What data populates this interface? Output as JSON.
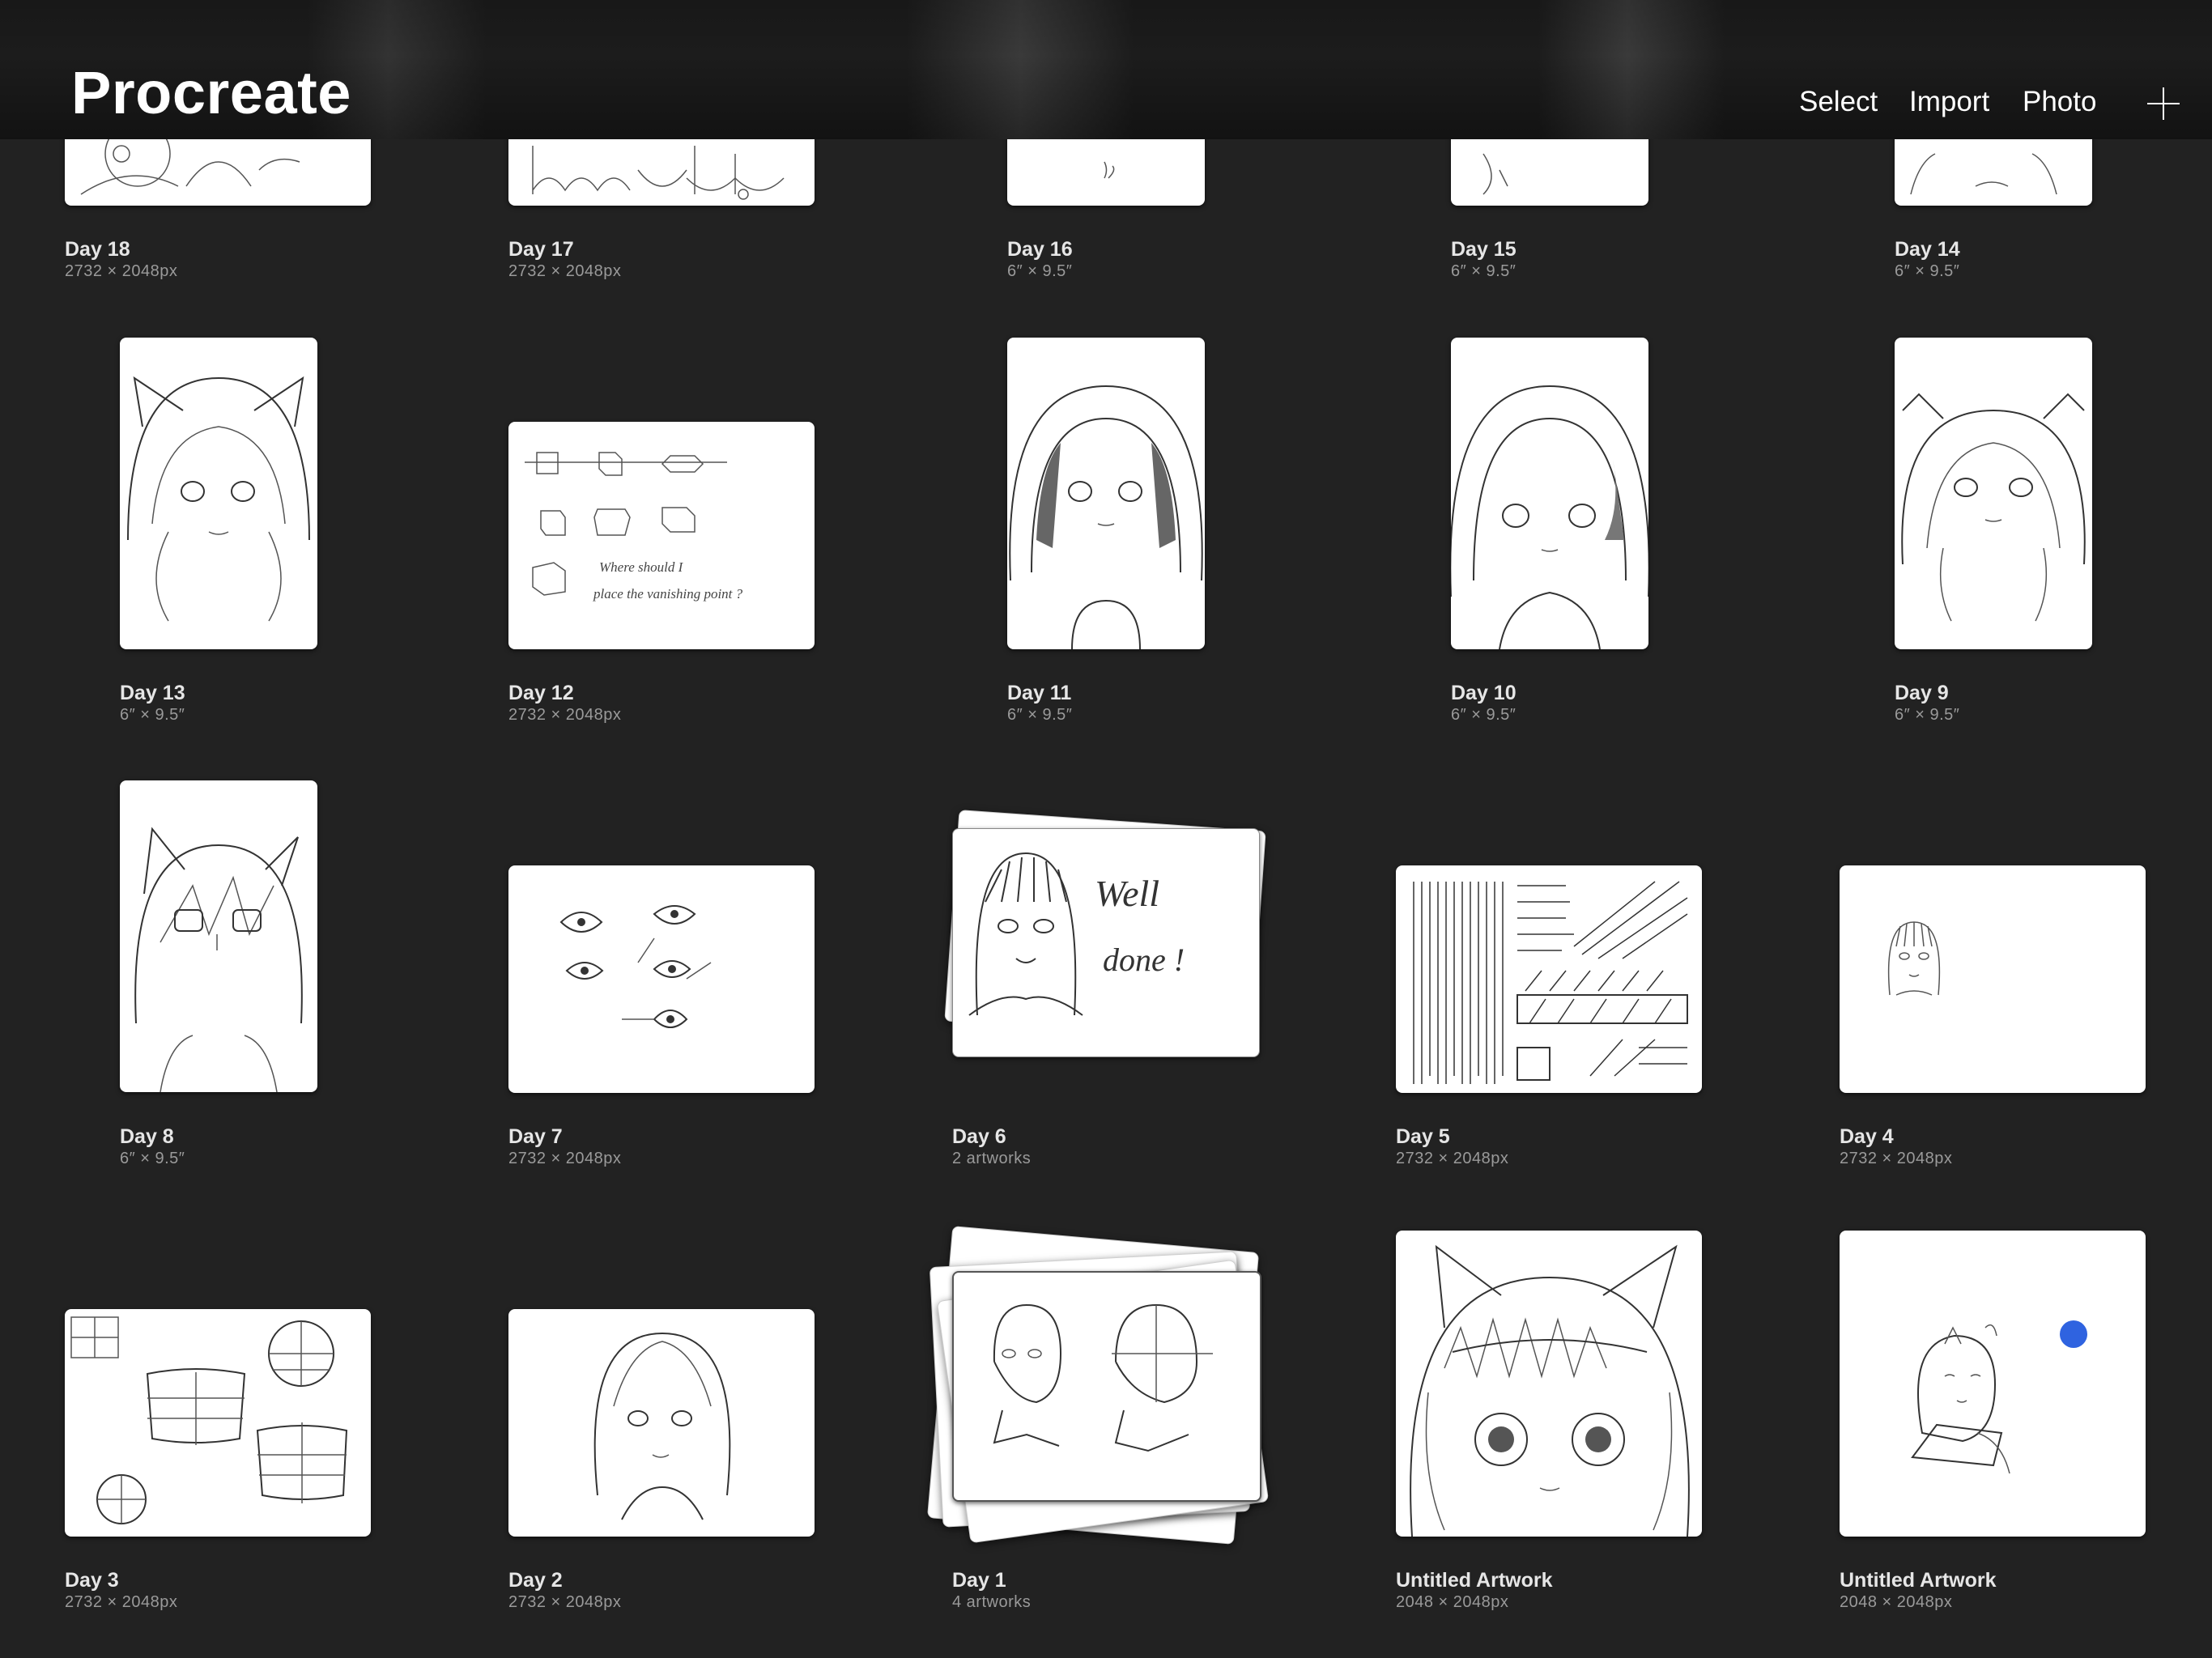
{
  "app": {
    "title": "Procreate",
    "select_label": "Select",
    "import_label": "Import",
    "photo_label": "Photo",
    "new_icon": "plus-icon"
  },
  "gallery": {
    "items": [
      {
        "title": "Day 18",
        "meta": "2732 × 2048px"
      },
      {
        "title": "Day 17",
        "meta": "2732 × 2048px"
      },
      {
        "title": "Day 16",
        "meta": "6″ × 9.5″"
      },
      {
        "title": "Day 15",
        "meta": "6″ × 9.5″"
      },
      {
        "title": "Day 14",
        "meta": "6″ × 9.5″"
      },
      {
        "title": "Day 13",
        "meta": "6″ × 9.5″"
      },
      {
        "title": "Day 12",
        "meta": "2732 × 2048px"
      },
      {
        "title": "Day 11",
        "meta": "6″ × 9.5″"
      },
      {
        "title": "Day 10",
        "meta": "6″ × 9.5″"
      },
      {
        "title": "Day 9",
        "meta": "6″ × 9.5″"
      },
      {
        "title": "Day 8",
        "meta": "6″ × 9.5″"
      },
      {
        "title": "Day 7",
        "meta": "2732 × 2048px"
      },
      {
        "title": "Day 6",
        "meta": "2 artworks",
        "sketch_text_1": "Well",
        "sketch_text_2": "done !"
      },
      {
        "title": "Day 5",
        "meta": "2732 × 2048px"
      },
      {
        "title": "Day 4",
        "meta": "2732 × 2048px"
      },
      {
        "title": "Day 3",
        "meta": "2732 × 2048px"
      },
      {
        "title": "Day 2",
        "meta": "2732 × 2048px"
      },
      {
        "title": "Day 1",
        "meta": "4 artworks"
      },
      {
        "title": "Untitled Artwork",
        "meta": "2048 × 2048px"
      },
      {
        "title": "Untitled Artwork",
        "meta": "2048 × 2048px"
      }
    ],
    "day12_text_1": "Where should I",
    "day12_text_2": "place the vanishing point ?",
    "accent_dot_color": "#2f63e0"
  }
}
